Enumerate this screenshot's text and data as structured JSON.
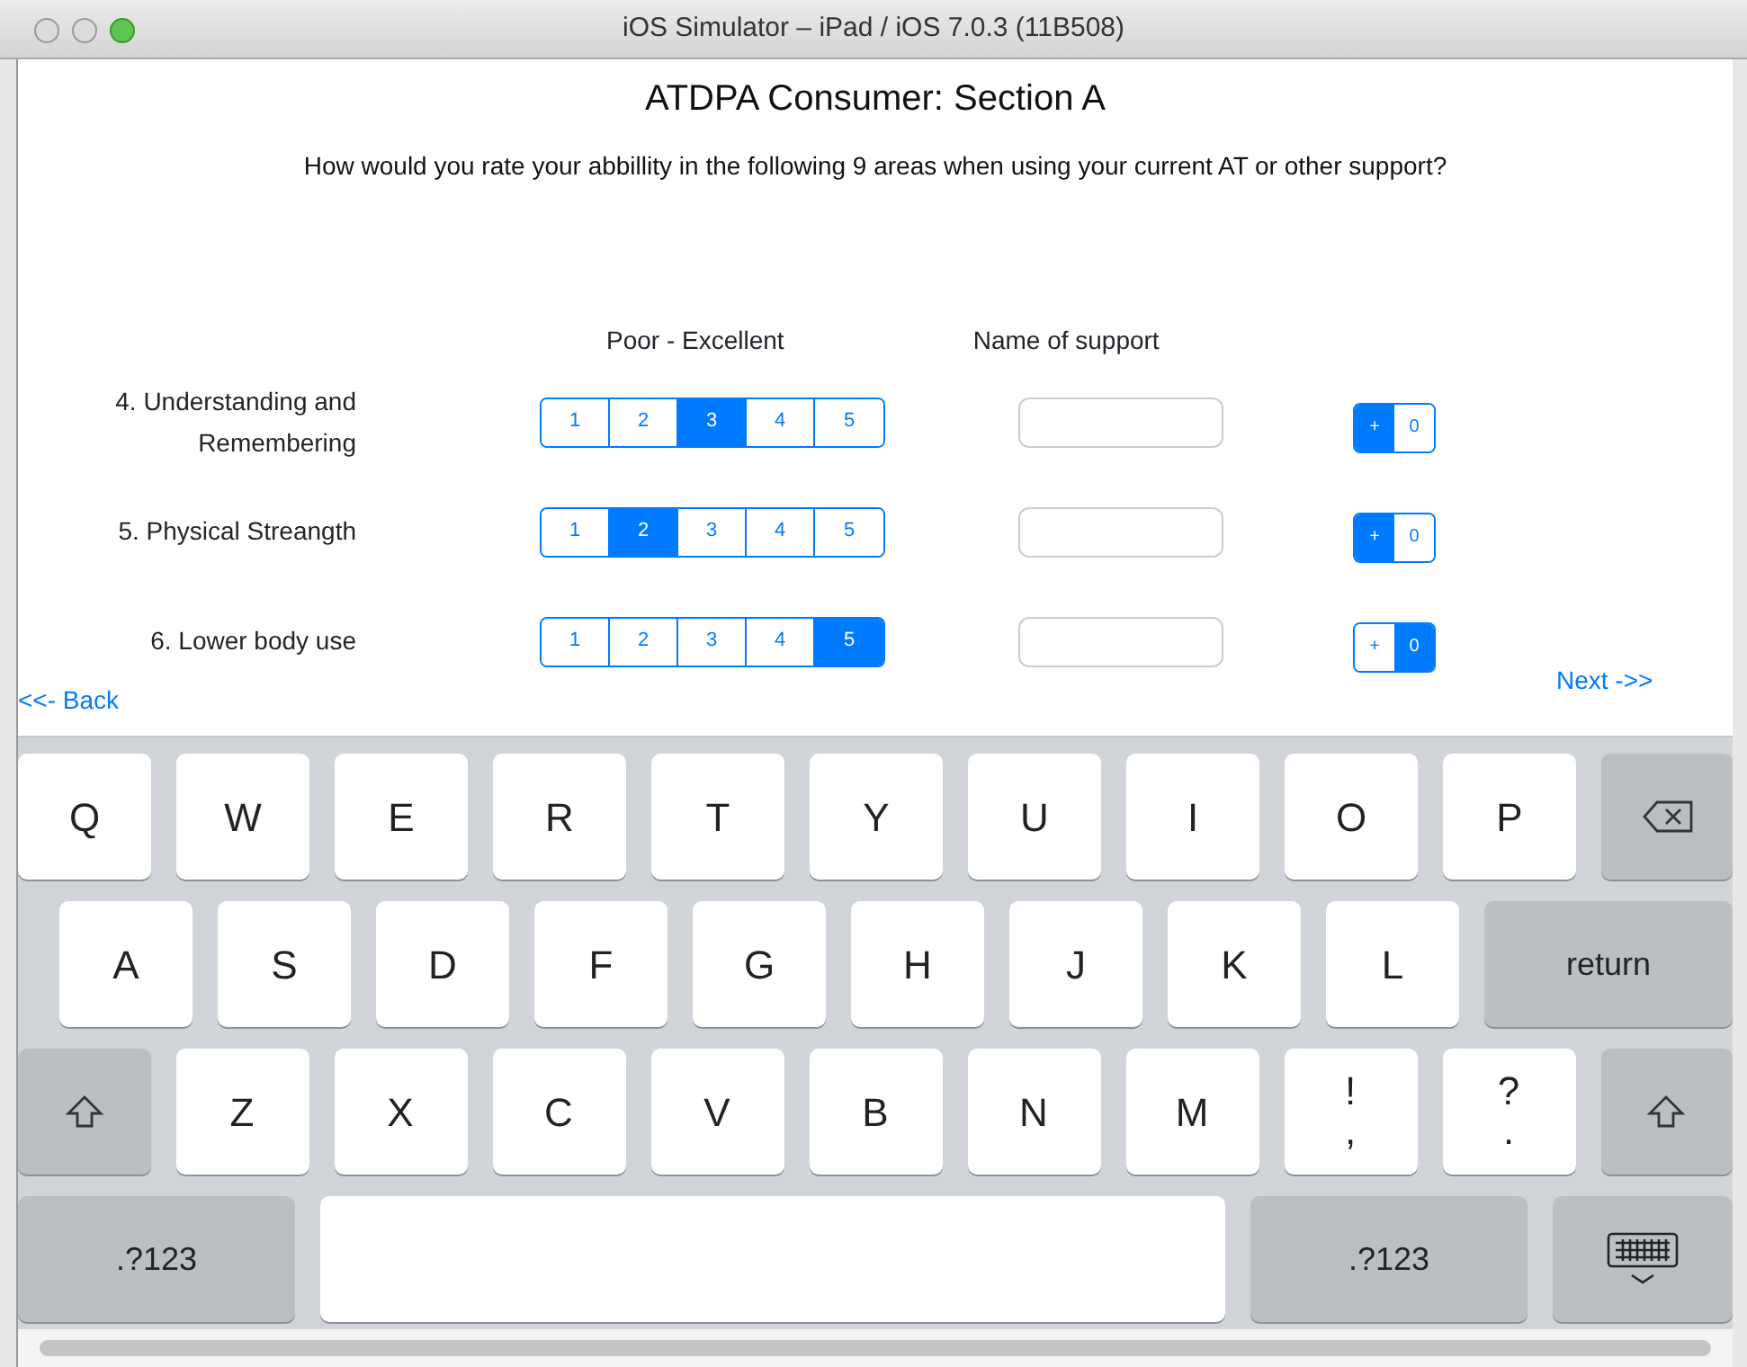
{
  "window": {
    "title": "iOS Simulator – iPad / iOS 7.0.3 (11B508)"
  },
  "page": {
    "title": "ATDPA Consumer: Section A",
    "question": "How would you rate your abbillity in the following 9 areas when using your current AT or other support?"
  },
  "columns": {
    "rating": "Poor - Excellent",
    "support": "Name of support"
  },
  "rows": [
    {
      "label": "4. Understanding and Remembering",
      "ratings": [
        {
          "label": "1",
          "selected": false
        },
        {
          "label": "2",
          "selected": false
        },
        {
          "label": "3",
          "selected": true
        },
        {
          "label": "4",
          "selected": false
        },
        {
          "label": "5",
          "selected": false
        }
      ],
      "stepper": [
        {
          "label": "+",
          "selected": true
        },
        {
          "label": "0",
          "selected": false
        }
      ]
    },
    {
      "label": "5. Physical Streangth",
      "ratings": [
        {
          "label": "1",
          "selected": false
        },
        {
          "label": "2",
          "selected": true
        },
        {
          "label": "3",
          "selected": false
        },
        {
          "label": "4",
          "selected": false
        },
        {
          "label": "5",
          "selected": false
        }
      ],
      "stepper": [
        {
          "label": "+",
          "selected": true
        },
        {
          "label": "0",
          "selected": false
        }
      ]
    },
    {
      "label": "6. Lower body use",
      "ratings": [
        {
          "label": "1",
          "selected": false
        },
        {
          "label": "2",
          "selected": false
        },
        {
          "label": "3",
          "selected": false
        },
        {
          "label": "4",
          "selected": false
        },
        {
          "label": "5",
          "selected": true
        }
      ],
      "stepper": [
        {
          "label": "+",
          "selected": false
        },
        {
          "label": "0",
          "selected": true
        }
      ]
    }
  ],
  "nav": {
    "back": "<<- Back",
    "next": "Next ->>"
  },
  "keyboard": {
    "rows": [
      [
        {
          "kind": "letter",
          "label": "Q"
        },
        {
          "kind": "letter",
          "label": "W"
        },
        {
          "kind": "letter",
          "label": "E"
        },
        {
          "kind": "letter",
          "label": "R"
        },
        {
          "kind": "letter",
          "label": "T"
        },
        {
          "kind": "letter",
          "label": "Y"
        },
        {
          "kind": "letter",
          "label": "U"
        },
        {
          "kind": "letter",
          "label": "I"
        },
        {
          "kind": "letter",
          "label": "O"
        },
        {
          "kind": "letter",
          "label": "P"
        },
        {
          "kind": "delete"
        }
      ],
      [
        {
          "kind": "letter",
          "label": "A"
        },
        {
          "kind": "letter",
          "label": "S"
        },
        {
          "kind": "letter",
          "label": "D"
        },
        {
          "kind": "letter",
          "label": "F"
        },
        {
          "kind": "letter",
          "label": "G"
        },
        {
          "kind": "letter",
          "label": "H"
        },
        {
          "kind": "letter",
          "label": "J"
        },
        {
          "kind": "letter",
          "label": "K"
        },
        {
          "kind": "letter",
          "label": "L"
        },
        {
          "kind": "return",
          "label": "return"
        }
      ],
      [
        {
          "kind": "shift"
        },
        {
          "kind": "letter",
          "label": "Z"
        },
        {
          "kind": "letter",
          "label": "X"
        },
        {
          "kind": "letter",
          "label": "C"
        },
        {
          "kind": "letter",
          "label": "V"
        },
        {
          "kind": "letter",
          "label": "B"
        },
        {
          "kind": "letter",
          "label": "N"
        },
        {
          "kind": "letter",
          "label": "M"
        },
        {
          "kind": "dual",
          "label": "!",
          "sub": ","
        },
        {
          "kind": "dual",
          "label": "?",
          "sub": "."
        },
        {
          "kind": "shift"
        }
      ],
      [
        {
          "kind": "mode",
          "label": ".?123"
        },
        {
          "kind": "space"
        },
        {
          "kind": "mode",
          "label": ".?123"
        },
        {
          "kind": "hide"
        }
      ]
    ]
  }
}
